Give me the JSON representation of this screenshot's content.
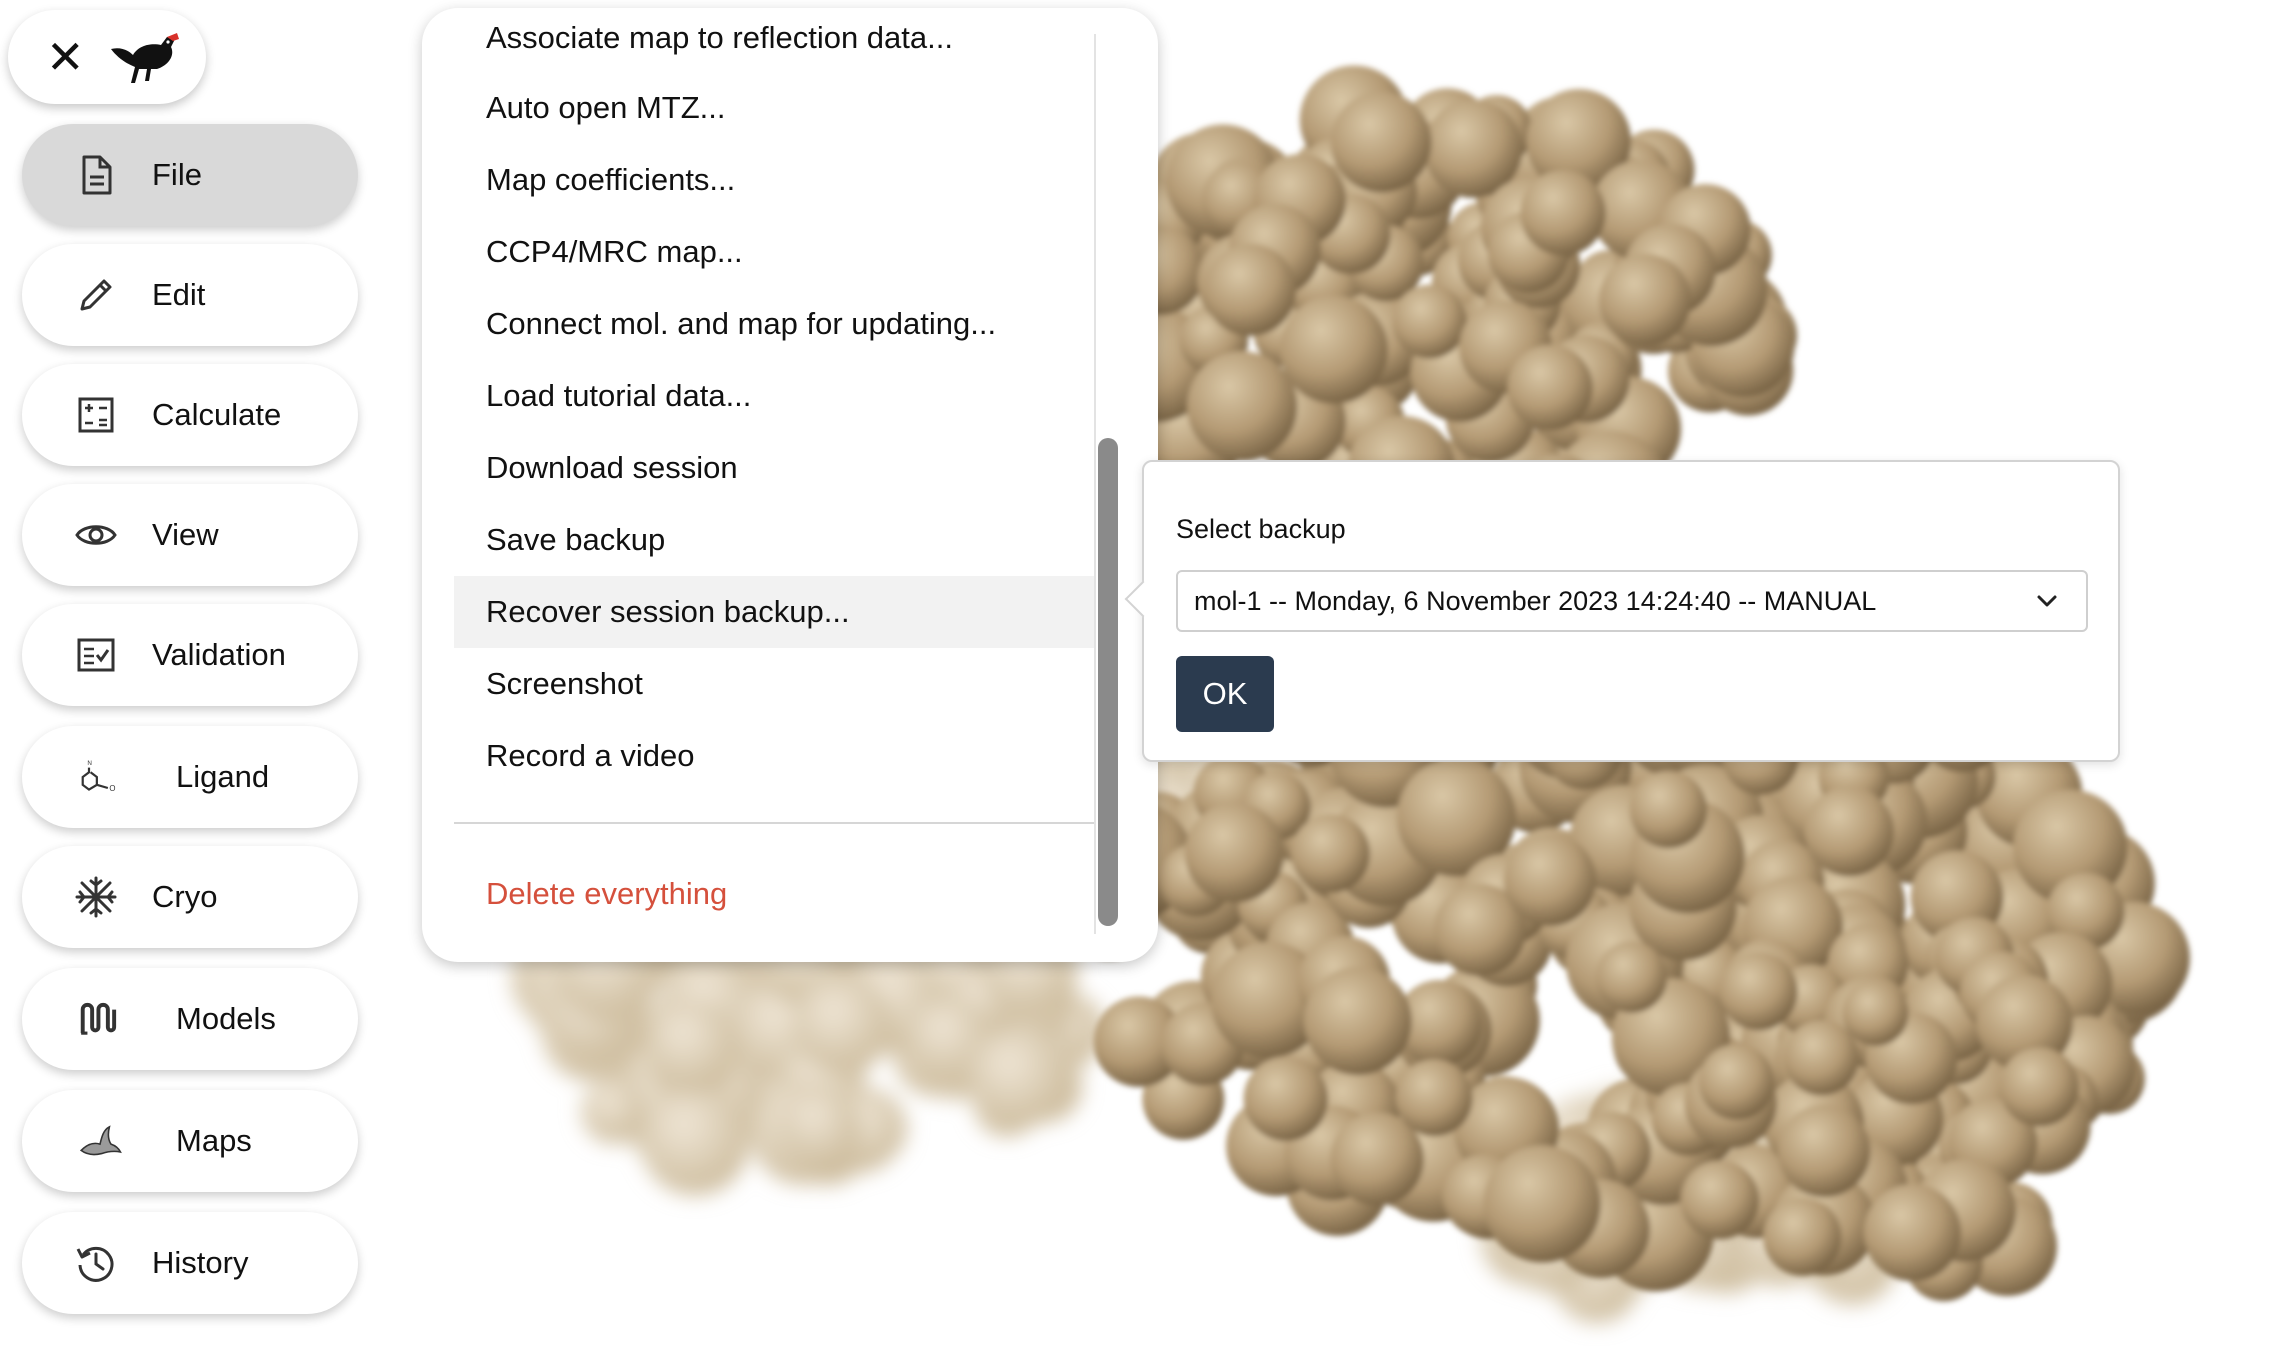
{
  "brand": {
    "close_glyph": "✕",
    "logo_icon": "moorhen-bird-icon"
  },
  "nav": [
    {
      "key": "file",
      "label": "File",
      "icon": "document-icon",
      "active": true
    },
    {
      "key": "edit",
      "label": "Edit",
      "icon": "pencil-icon"
    },
    {
      "key": "calculate",
      "label": "Calculate",
      "icon": "calculator-icon"
    },
    {
      "key": "view",
      "label": "View",
      "icon": "eye-icon"
    },
    {
      "key": "validation",
      "label": "Validation",
      "icon": "checklist-icon"
    },
    {
      "key": "ligand",
      "label": "Ligand",
      "icon": "molecule-icon"
    },
    {
      "key": "cryo",
      "label": "Cryo",
      "icon": "snowflake-icon"
    },
    {
      "key": "models",
      "label": "Models",
      "icon": "models-icon"
    },
    {
      "key": "maps",
      "label": "Maps",
      "icon": "maps-icon"
    },
    {
      "key": "history",
      "label": "History",
      "icon": "history-icon"
    }
  ],
  "file_menu": {
    "items": [
      "Associate map to reflection data...",
      "Auto open MTZ...",
      "Map coefficients...",
      "CCP4/MRC map...",
      "Connect mol. and map for updating...",
      "Load tutorial data...",
      "Download session",
      "Save backup",
      "Recover session backup...",
      "Screenshot",
      "Record a video"
    ],
    "highlighted": "Recover session backup...",
    "danger_item": "Delete everything"
  },
  "backup_popover": {
    "title": "Select backup",
    "selected": "mol-1 -- Monday, 6 November 2023 14:24:40 -- MANUAL",
    "ok_label": "OK"
  },
  "colors": {
    "nav_active_bg": "#d9d9d9",
    "ok_button_bg": "#2b3b4f",
    "danger_text": "#d5503c",
    "molecule_surface": "#b89f7a"
  }
}
